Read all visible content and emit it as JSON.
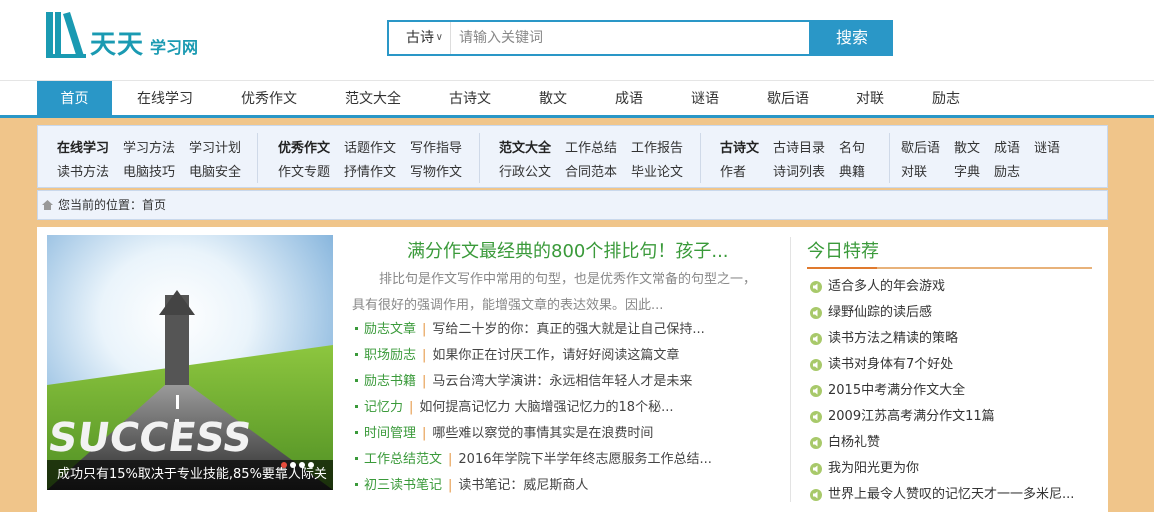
{
  "logo": {
    "big": "天天",
    "small": "学习网"
  },
  "search": {
    "type_label": "古诗",
    "placeholder": "请输入关键词",
    "button_label": "搜索"
  },
  "nav": [
    "首页",
    "在线学习",
    "优秀作文",
    "范文大全",
    "古诗文",
    "散文",
    "成语",
    "谜语",
    "歇后语",
    "对联",
    "励志"
  ],
  "subnav": {
    "g1": [
      "在线学习",
      "学习方法",
      "学习计划",
      "读书方法",
      "电脑技巧",
      "电脑安全"
    ],
    "g2": [
      "优秀作文",
      "话题作文",
      "写作指导",
      "作文专题",
      "抒情作文",
      "写物作文"
    ],
    "g3": [
      "范文大全",
      "工作总结",
      "工作报告",
      "行政公文",
      "合同范本",
      "毕业论文"
    ],
    "g4": [
      "古诗文",
      "古诗目录",
      "名句",
      "作者",
      "诗词列表",
      "典籍"
    ],
    "g5": [
      "歇后语",
      "散文",
      "成语",
      "谜语",
      "对联",
      "字典",
      "励志"
    ]
  },
  "breadcrumb": "您当前的位置：首页",
  "slide": {
    "caption": "成功只有15%取决于专业技能,85%要靠人际关",
    "image_text": "SUCCESS"
  },
  "headline": "满分作文最经典的800个排比句！孩子...",
  "summary": "排比句是作文写作中常用的句型，也是优秀作文常备的句型之一，具有很好的强调作用，能增强文章的表达效果。因此...",
  "articles": [
    {
      "cat": "励志文章",
      "title": "写给二十岁的你：真正的强大就是让自己保持..."
    },
    {
      "cat": "职场励志",
      "title": "如果你正在讨厌工作，请好好阅读这篇文章"
    },
    {
      "cat": "励志书籍",
      "title": "马云台湾大学演讲：永远相信年轻人才是未来"
    },
    {
      "cat": "记忆力",
      "title": "如何提高记忆力 大脑增强记忆力的18个秘..."
    },
    {
      "cat": "时间管理",
      "title": "哪些难以察觉的事情其实是在浪费时间"
    },
    {
      "cat": "工作总结范文",
      "title": "2016年学院下半学年终志愿服务工作总结..."
    },
    {
      "cat": "初三读书笔记",
      "title": "读书笔记：威尼斯商人"
    }
  ],
  "recommend": {
    "heading": "今日特荐",
    "items": [
      "适合多人的年会游戏",
      "绿野仙踪的读后感",
      "读书方法之精读的策略",
      "读书对身体有7个好处",
      "2015中考满分作文大全",
      "2009江苏高考满分作文11篇",
      "白杨礼赞",
      "我为阳光更为你",
      "世界上最令人赞叹的记忆天才一一多米尼..."
    ]
  },
  "colors": {
    "primary": "#2a97c7",
    "green": "#3a9a3a",
    "orange": "#e07a2e",
    "background": "#f0c58a"
  }
}
